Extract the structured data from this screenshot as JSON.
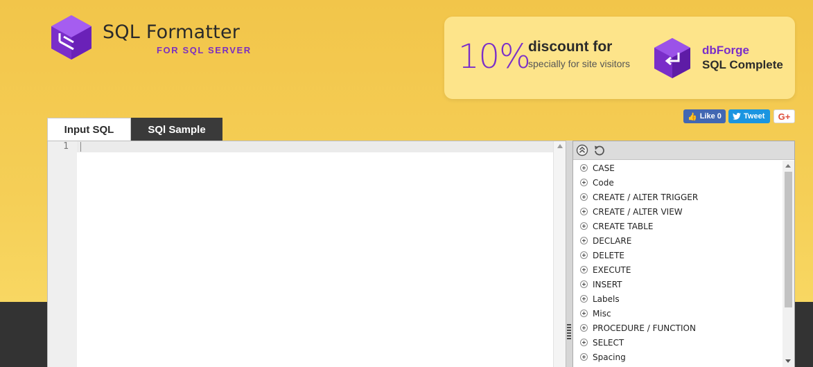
{
  "brand": {
    "title": "SQL Formatter",
    "subtitle": "FOR SQL SERVER",
    "logo_icon": "cube-logo-icon"
  },
  "promo": {
    "percent": "10%",
    "headline": "discount for",
    "subline": "specially for site visitors",
    "product_line1": "dbForge",
    "product_line2": "SQL Complete",
    "icon": "dbforge-complete-icon"
  },
  "social": {
    "facebook_label": "Like 0",
    "twitter_label": "Tweet",
    "google_label": "G+"
  },
  "tabs": [
    {
      "label": "Input SQL",
      "active": true
    },
    {
      "label": "SQl Sample",
      "active": false
    }
  ],
  "editor": {
    "line_numbers": [
      "1"
    ],
    "content": ""
  },
  "options_panel": {
    "toolbar": [
      "collapse-all-icon",
      "reset-icon"
    ],
    "items": [
      "CASE",
      "Code",
      "CREATE / ALTER TRIGGER",
      "CREATE / ALTER VIEW",
      "CREATE TABLE",
      "DECLARE",
      "DELETE",
      "EXECUTE",
      "INSERT",
      "Labels",
      "Misc",
      "PROCEDURE / FUNCTION",
      "SELECT",
      "Spacing"
    ]
  },
  "colors": {
    "background": "#f5cf57",
    "accent_purple": "#7a2ec9",
    "dark_band": "#333333",
    "promo_bg": "#fde48a"
  }
}
